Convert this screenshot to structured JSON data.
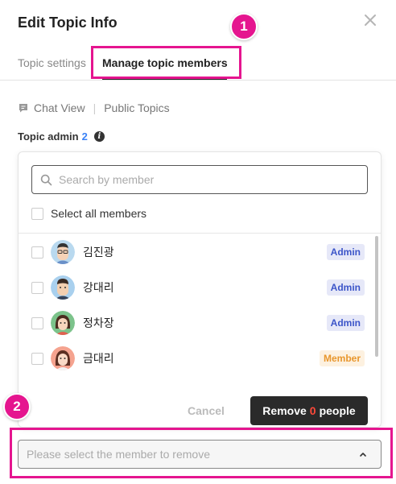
{
  "dialog": {
    "title": "Edit Topic Info"
  },
  "tabs": [
    {
      "label": "Topic settings",
      "active": false
    },
    {
      "label": "Manage topic members",
      "active": true
    }
  ],
  "breadcrumb": {
    "chat_view": "Chat View",
    "separator": "|",
    "public_topics": "Public Topics"
  },
  "topic_admin": {
    "label": "Topic admin",
    "count": "2",
    "info_icon": "i"
  },
  "search": {
    "placeholder": "Search by member",
    "value": ""
  },
  "select_all": {
    "label": "Select all members"
  },
  "members": [
    {
      "name": "김진광",
      "role": "Admin"
    },
    {
      "name": "강대리",
      "role": "Admin"
    },
    {
      "name": "정차장",
      "role": "Admin"
    },
    {
      "name": "금대리",
      "role": "Member"
    }
  ],
  "actions": {
    "cancel": "Cancel",
    "remove_prefix": "Remove",
    "remove_count": "0",
    "remove_suffix": "people"
  },
  "remove_select": {
    "placeholder": "Please select the member to remove"
  },
  "annotations": {
    "badge_1": "1",
    "badge_2": "2"
  },
  "colors": {
    "accent": "#e5158f",
    "admin_badge_text": "#3c55c9",
    "member_badge_text": "#e8962d",
    "remove_count": "#ff4a3a"
  }
}
